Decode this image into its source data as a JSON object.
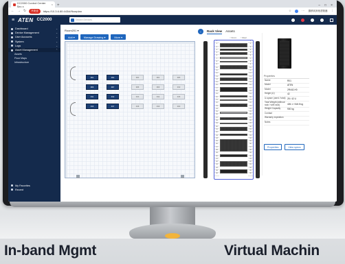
{
  "browser": {
    "tab_title": "CC2000 Control Center Sec x",
    "new_tab": "+",
    "secure_label": "不安全",
    "url": "https://10.3.6.80:443/#/floorplan",
    "addr_text": "遷移到其他瀏覽器",
    "window_controls": [
      "–",
      "□",
      "×"
    ]
  },
  "header": {
    "brand": "ATEN",
    "product": "CC2000",
    "search_placeholder": "Search Devices"
  },
  "sidebar": {
    "items": [
      {
        "label": "Dashboard",
        "chevron": "⌄"
      },
      {
        "label": "Device Management",
        "chevron": "⌄"
      },
      {
        "label": "User Accounts",
        "chevron": "⌄"
      },
      {
        "label": "System",
        "chevron": "⌄"
      },
      {
        "label": "Logs",
        "chevron": "⌄"
      },
      {
        "label": "Asset Management",
        "chevron": "⌃"
      }
    ],
    "subitems": [
      "Assets",
      "Floor Maps",
      "Infrastructure"
    ],
    "bottom": [
      {
        "label": "My Favorites"
      },
      {
        "label": "Recent"
      }
    ]
  },
  "floor": {
    "breadcrumb": "Room201 ▾",
    "buttons": [
      "Add ▾",
      "Manage Drawing ▾",
      "More ▾"
    ],
    "racks": [
      {
        "label": "R01",
        "state": "blue"
      },
      {
        "label": "R02",
        "state": "blue"
      },
      {
        "label": "R03",
        "state": "gray"
      },
      {
        "label": "R04",
        "state": "gray"
      },
      {
        "label": "R05",
        "state": "gray"
      },
      {
        "label": "R06",
        "state": "blue"
      },
      {
        "label": "R07",
        "state": "blue"
      },
      {
        "label": "R08",
        "state": "gray"
      },
      {
        "label": "R09",
        "state": "gray"
      },
      {
        "label": "R10",
        "state": "gray"
      },
      {
        "label": "R11",
        "state": "blue"
      },
      {
        "label": "R12",
        "state": "blue"
      },
      {
        "label": "R13",
        "state": "gray"
      },
      {
        "label": "R14",
        "state": "gray"
      },
      {
        "label": "R15",
        "state": "gray"
      },
      {
        "label": "R16",
        "state": "blue"
      },
      {
        "label": "R17",
        "state": "blue"
      },
      {
        "label": "R18",
        "state": "gray"
      },
      {
        "label": "R19",
        "state": "gray"
      },
      {
        "label": "R20",
        "state": "gray"
      }
    ]
  },
  "rackview": {
    "back": "‹",
    "tabs": [
      "Rack View",
      "Assets"
    ],
    "legend": [
      "Front",
      "Rear"
    ]
  },
  "detail": {
    "title": "Properties",
    "properties": [
      {
        "k": "Name",
        "v": "R01"
      },
      {
        "k": "Model",
        "v": "ATEN"
      },
      {
        "k": "Model",
        "v": "2R442-H0"
      },
      {
        "k": "Height (U)",
        "v": "42"
      },
      {
        "k": "U-space (used / total)",
        "v": "25 / 42 U"
      },
      {
        "k": "Total Weight (without rack / with rack)",
        "v": "426.1 / 518.5 kg"
      },
      {
        "k": "Weight Capacity",
        "v": "900 kg"
      },
      {
        "k": "Contact",
        "v": ""
      },
      {
        "k": "Warranty expiration",
        "v": ""
      },
      {
        "k": "Notes",
        "v": ""
      }
    ],
    "buttons": [
      "Properties",
      "View specs"
    ]
  },
  "captions": {
    "left": "In-band Mgmt",
    "right": "Virtual Machin"
  },
  "colors": {
    "header": "#142a4c",
    "accent": "#1f66bd",
    "rack_blue": "#1c3f73",
    "rack_frame": "#5060d8",
    "alert": "#e63946"
  }
}
